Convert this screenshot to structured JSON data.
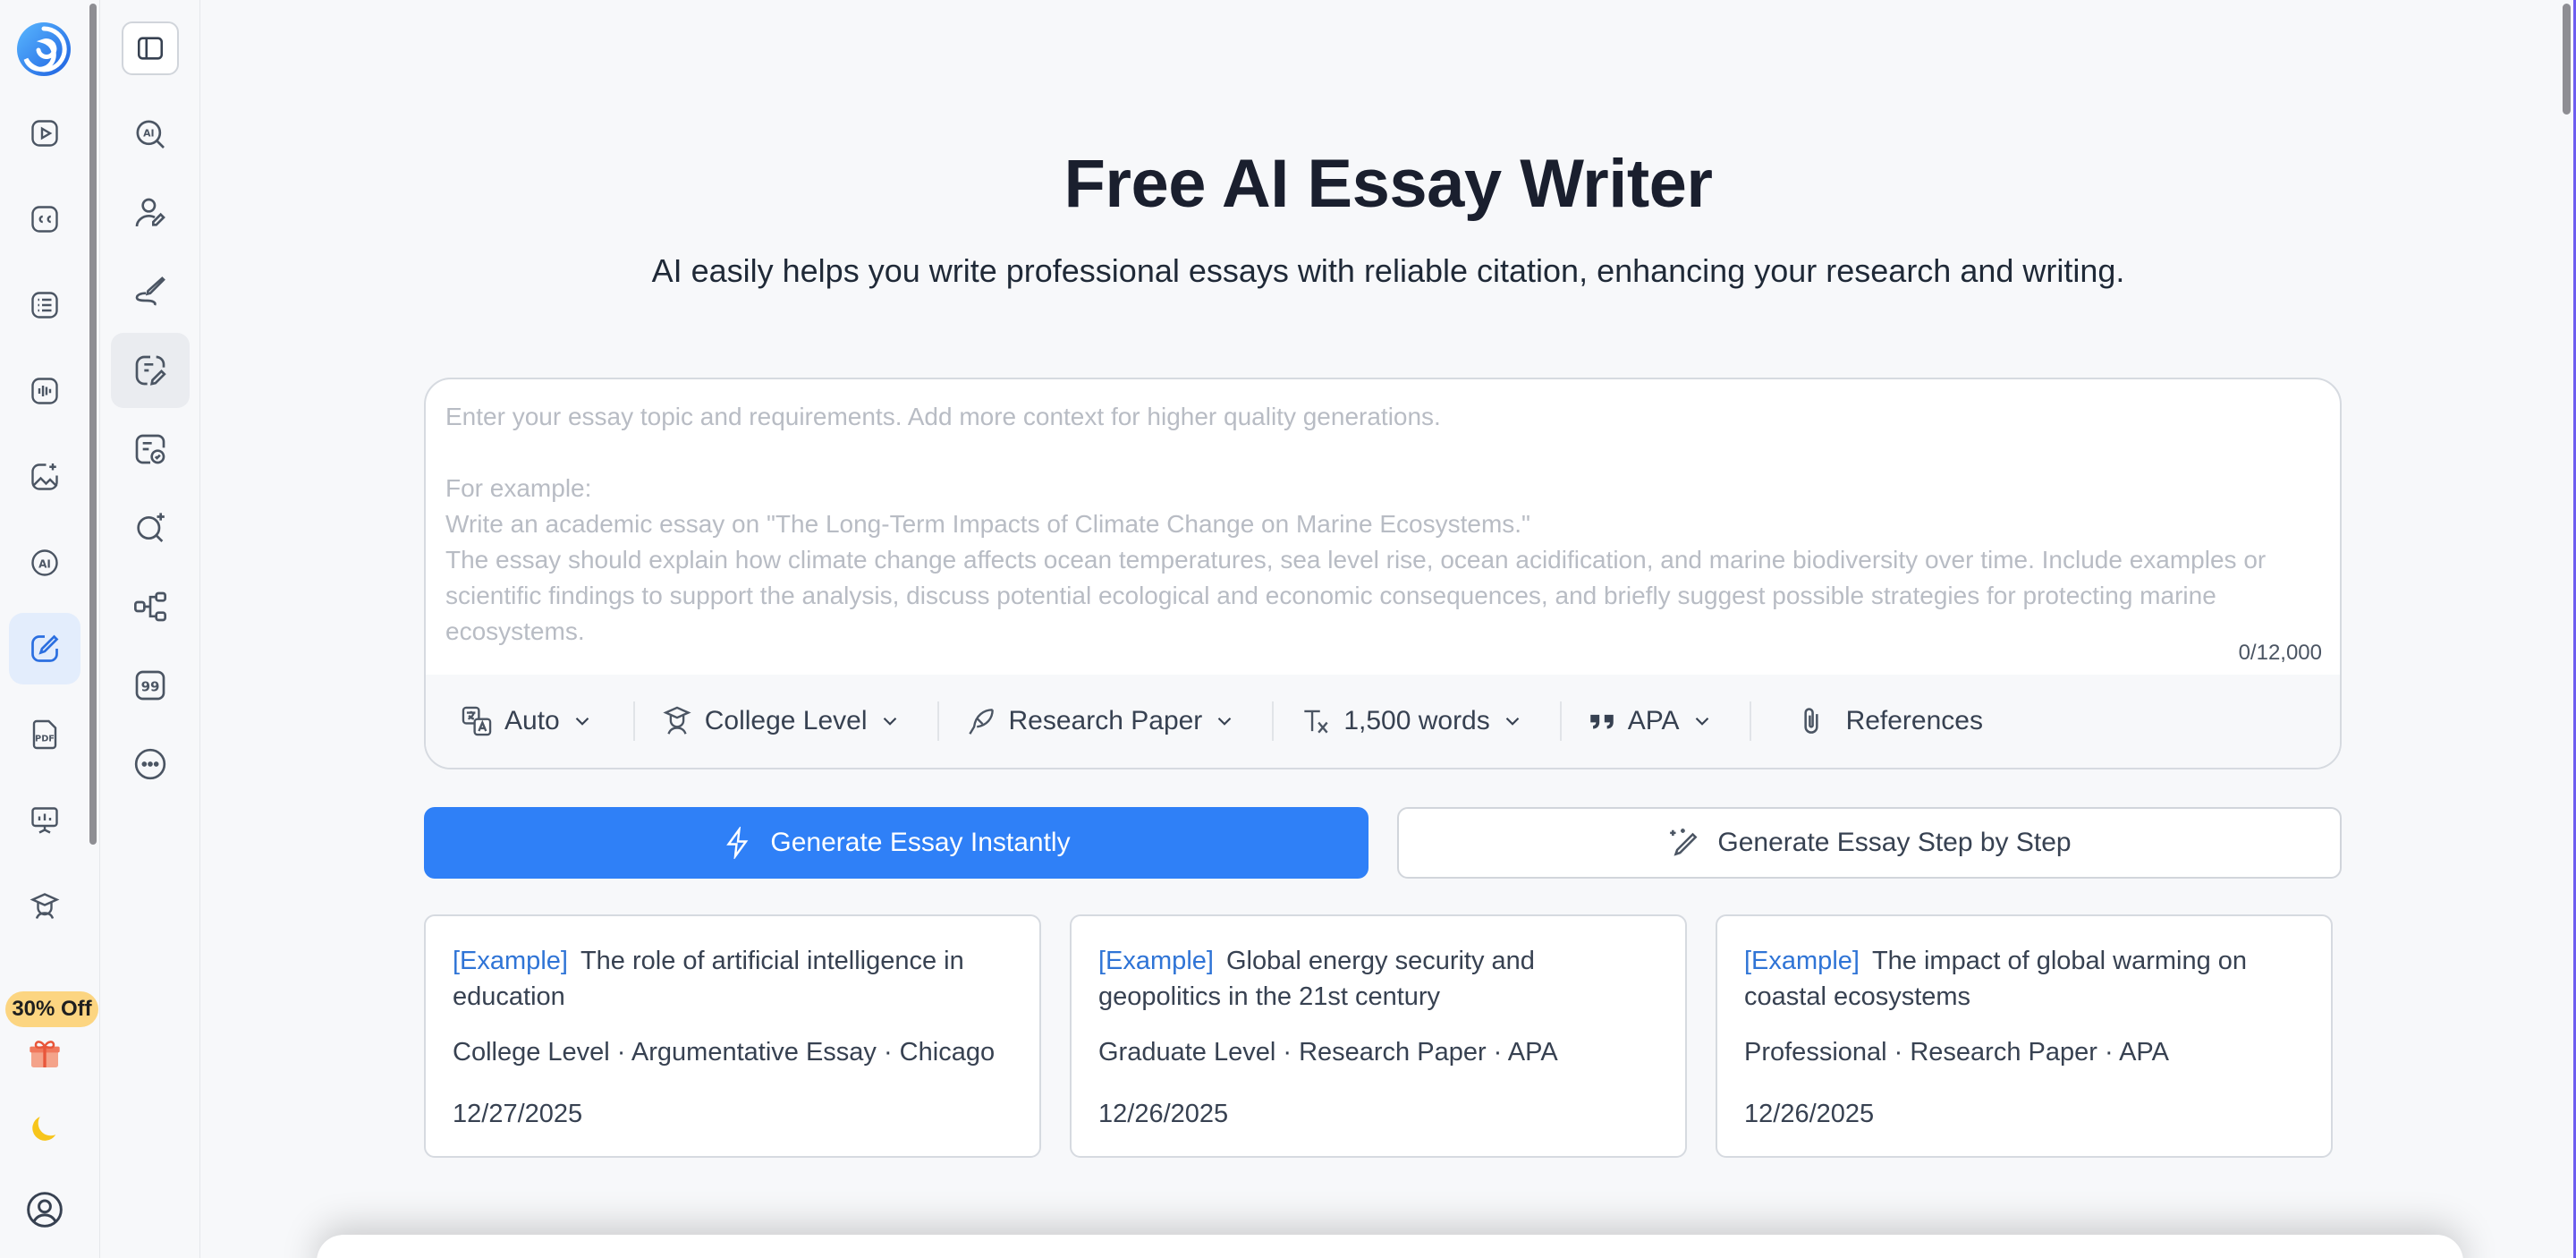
{
  "promo": {
    "label": "30% Off"
  },
  "header": {
    "title": "Free AI Essay Writer",
    "subtitle": "AI easily helps you write professional essays with reliable citation, enhancing your research and writing."
  },
  "editor": {
    "value": "",
    "placeholder": "Enter your essay topic and requirements. Add more context for higher quality generations.\n\nFor example:\nWrite an academic essay on \"The Long-Term Impacts of Climate Change on Marine Ecosystems.\"\nThe essay should explain how climate change affects ocean temperatures, sea level rise, ocean acidification, and marine biodiversity over time. Include examples or scientific findings to support the analysis, discuss potential ecological and economic consequences, and briefly suggest possible strategies for protecting marine ecosystems.",
    "counter": "0/12,000"
  },
  "options": {
    "language": "Auto",
    "level": "College Level",
    "type": "Research Paper",
    "length": "1,500 words",
    "citation": "APA",
    "references": "References"
  },
  "actions": {
    "primary": "Generate Essay Instantly",
    "secondary": "Generate Essay Step by Step"
  },
  "examples": [
    {
      "tag": "[Example]",
      "title": "The role of artificial intelligence in education",
      "meta": "College Level · Argumentative Essay · Chicago",
      "date": "12/27/2025"
    },
    {
      "tag": "[Example]",
      "title": "Global energy security and geopolitics in the 21st century",
      "meta": "Graduate Level · Research Paper · APA",
      "date": "12/26/2025"
    },
    {
      "tag": "[Example]",
      "title": "The impact of global warming on coastal ecosystems",
      "meta": "Professional · Research Paper · APA",
      "date": "12/26/2025"
    }
  ],
  "colors": {
    "accent": "#2f80f7",
    "active_bg": "#e3edfc",
    "promo": "#fcd581"
  }
}
